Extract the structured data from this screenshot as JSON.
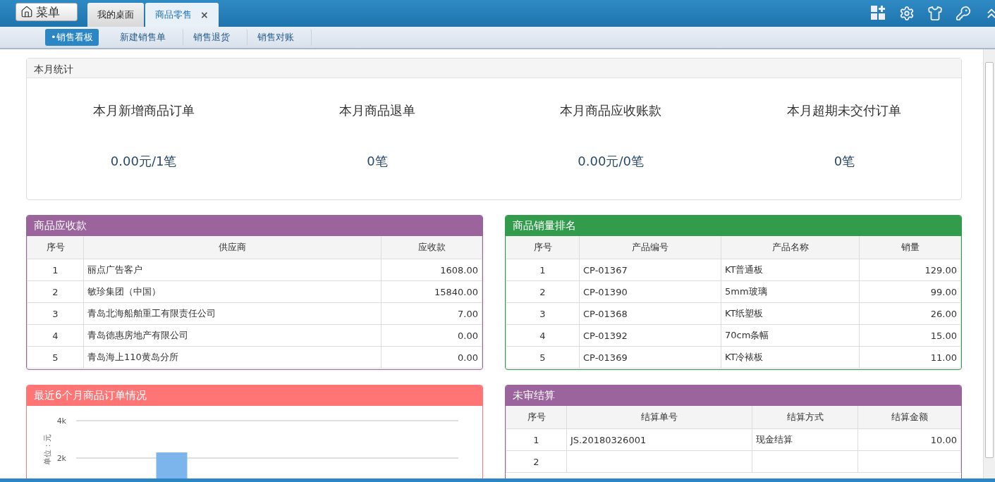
{
  "menu_button": {
    "label": "菜单"
  },
  "tabs": [
    {
      "label": "我的桌面",
      "selected": false,
      "closable": false
    },
    {
      "label": "商品零售",
      "selected": true,
      "closable": true,
      "close": "×"
    }
  ],
  "subnav": [
    {
      "label": "•销售看板",
      "selected": true
    },
    {
      "label": "新建销售单",
      "selected": false
    },
    {
      "label": "销售退货",
      "selected": false
    },
    {
      "label": "销售对账",
      "selected": false
    }
  ],
  "stats": {
    "title": "本月统计",
    "items": [
      {
        "label": "本月新增商品订单",
        "value": "0.00元/1笔"
      },
      {
        "label": "本月商品退单",
        "value": "0笔"
      },
      {
        "label": "本月商品应收账款",
        "value": "0.00元/0笔"
      },
      {
        "label": "本月超期未交付订单",
        "value": "0笔"
      }
    ]
  },
  "panels": [
    {
      "kind": "table",
      "title": "商品应收款",
      "color": "#9b649d",
      "columns": [
        "序号",
        "供应商",
        "应收款"
      ],
      "rows": [
        [
          "1",
          "丽点广告客户",
          "1608.00"
        ],
        [
          "2",
          "敏珍集团（中国）",
          "15840.00"
        ],
        [
          "3",
          "青岛北海船舶重工有限责任公司",
          "7.00"
        ],
        [
          "4",
          "青岛德惠房地产有限公司",
          "0.00"
        ],
        [
          "5",
          "青岛海上110黄岛分所",
          "0.00"
        ]
      ]
    },
    {
      "kind": "table",
      "title": "商品销量排名",
      "color": "#339c4c",
      "columns": [
        "序号",
        "产品编号",
        "产品名称",
        "销量"
      ],
      "rows": [
        [
          "1",
          "CP-01367",
          "KT普通板",
          "129.00"
        ],
        [
          "2",
          "CP-01390",
          "5mm玻璃",
          "99.00"
        ],
        [
          "3",
          "CP-01368",
          "KT纸塑板",
          "26.00"
        ],
        [
          "4",
          "CP-01392",
          "70cm条幅",
          "15.00"
        ],
        [
          "5",
          "CP-01369",
          "KT冷裱板",
          "11.00"
        ]
      ]
    },
    {
      "kind": "chart",
      "title": "最近6个月商品订单情况",
      "color": "#ff7474",
      "chart_data": {
        "type": "bar",
        "ylabel": "单位：元",
        "ylim": [
          0,
          4000
        ],
        "yticks": [
          {
            "value": 2000,
            "label": "2k"
          },
          {
            "value": 4000,
            "label": "4k"
          }
        ],
        "series": [
          {
            "color": "#7cb5ec",
            "values": [
              null,
              2300,
              null,
              null,
              null,
              null
            ]
          }
        ]
      }
    },
    {
      "kind": "table",
      "title": "未审结算",
      "color": "#9b649d",
      "columns": [
        "序号",
        "结算单号",
        "结算方式",
        "结算金额"
      ],
      "rows": [
        [
          "1",
          "JS.20180326001",
          "现金结算",
          "10.00"
        ],
        [
          "2",
          "",
          "",
          ""
        ]
      ]
    }
  ]
}
